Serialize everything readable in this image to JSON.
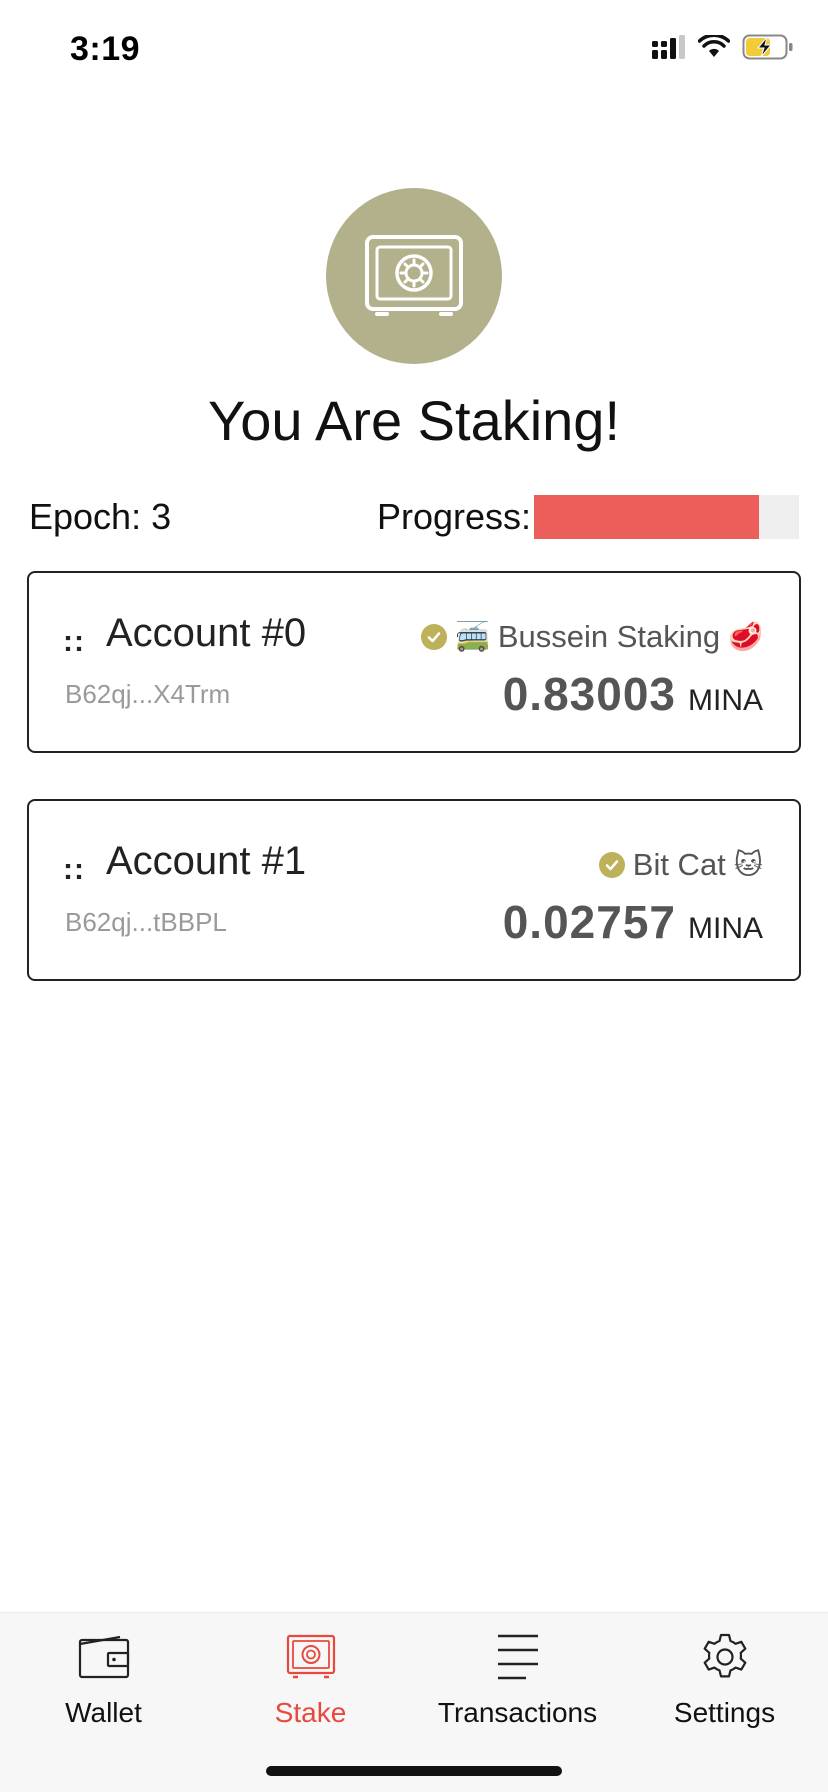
{
  "status_bar": {
    "time": "3:19"
  },
  "hero": {
    "title": "You Are Staking!",
    "icon": "vault-icon"
  },
  "epoch": {
    "label": "Epoch: 3",
    "progress_label": "Progress:",
    "progress_fraction": 0.85
  },
  "accounts": [
    {
      "handle": "::",
      "name": "Account #0",
      "address": "B62qj...X4Trm",
      "validator_name": "Bussein Staking",
      "validator_prefix_emoji": "🚎",
      "validator_suffix_emoji": "🥩",
      "balance": "0.83003",
      "unit": "MINA"
    },
    {
      "handle": "::",
      "name": "Account #1",
      "address": "B62qj...tBBPL",
      "validator_name": "Bit Cat",
      "validator_suffix_emoji": "🐱",
      "balance": "0.02757",
      "unit": "MINA"
    }
  ],
  "tabs": [
    {
      "label": "Wallet",
      "icon": "wallet-icon",
      "active": false
    },
    {
      "label": "Stake",
      "icon": "vault-icon",
      "active": true
    },
    {
      "label": "Transactions",
      "icon": "list-icon",
      "active": false
    },
    {
      "label": "Settings",
      "icon": "gear-icon",
      "active": false
    }
  ],
  "colors": {
    "accent": "#e8493f",
    "progress": "#eb5e5a",
    "vault_bg": "#b3b08c",
    "verified": "#bdb15a"
  }
}
